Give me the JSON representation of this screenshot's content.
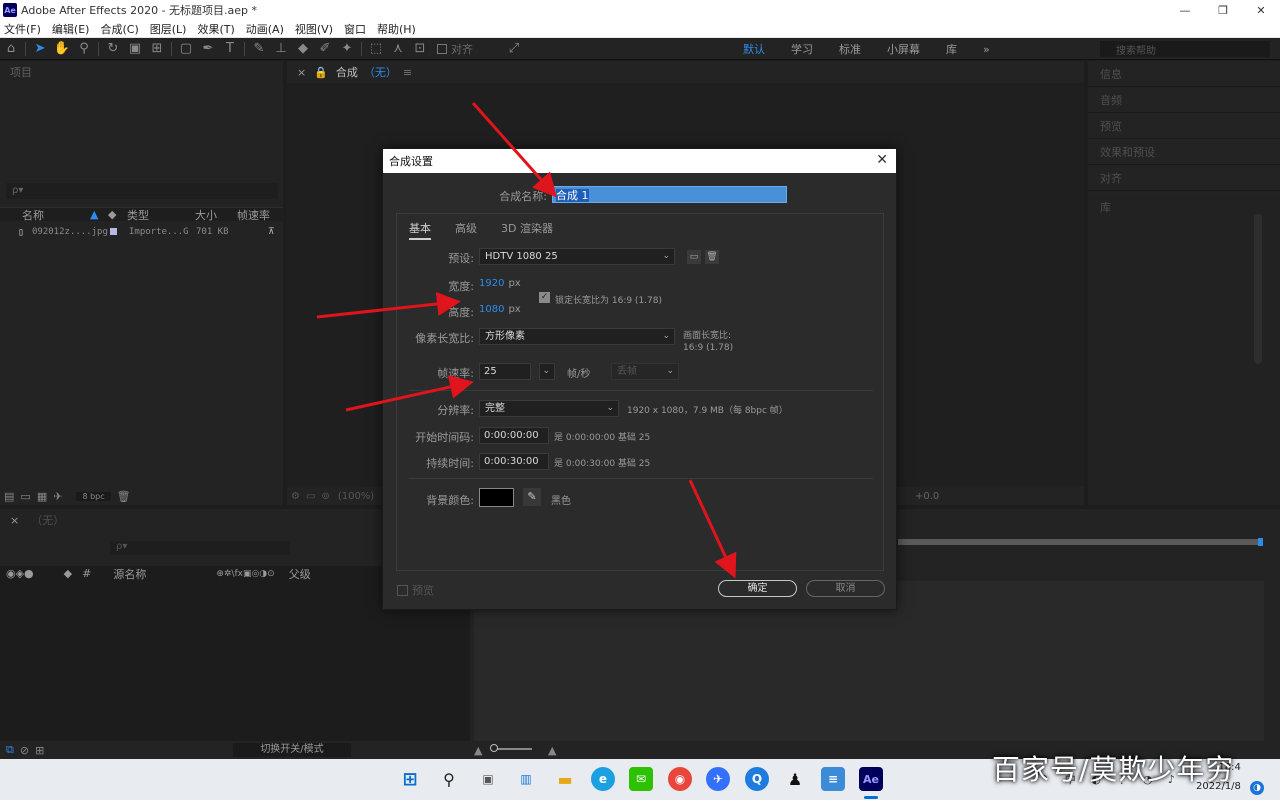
{
  "app": {
    "title": "Adobe After Effects 2020 - 无标题项目.aep *",
    "logo": "Ae",
    "accent": "#2d8ceb"
  },
  "window_controls": {
    "minimize": "—",
    "maximize": "❐",
    "close": "✕"
  },
  "menu": [
    "文件(F)",
    "编辑(E)",
    "合成(C)",
    "图层(L)",
    "效果(T)",
    "动画(A)",
    "视图(V)",
    "窗口",
    "帮助(H)"
  ],
  "toolbar": {
    "snap_label": "对齐",
    "workspaces": [
      "默认",
      "学习",
      "标准",
      "小屏幕",
      "库"
    ],
    "active_workspace": "默认",
    "search_placeholder": "搜索帮助"
  },
  "project_panel": {
    "title": "项目",
    "search_placeholder": "ρ▾",
    "columns": [
      "名称",
      "类型",
      "大小",
      "帧速率"
    ],
    "items": [
      {
        "name": "092012z....jpg",
        "type": "Importe...G",
        "size": "701 KB"
      }
    ],
    "bpc": "8 bpc"
  },
  "comp_panel": {
    "tab_label": "合成",
    "tab_value": "（无）",
    "zoom": "(100%)",
    "exposure": "+0.0"
  },
  "right_panels": [
    "信息",
    "音频",
    "预览",
    "效果和预设",
    "对齐"
  ],
  "library_label": "库",
  "timeline": {
    "tab": "（无）",
    "columns": {
      "source_name": "源名称",
      "parent": "父级",
      "hash": "#"
    },
    "toggle_label": "切换开关/模式"
  },
  "dialog": {
    "title": "合成设置",
    "name_label": "合成名称:",
    "name_value": "合成 1",
    "tabs": [
      "基本",
      "高级",
      "3D 渲染器"
    ],
    "preset_label": "预设:",
    "preset_value": "HDTV 1080 25",
    "width_label": "宽度:",
    "width_value": "1920",
    "height_label": "高度:",
    "height_value": "1080",
    "px": "px",
    "lock_aspect": "锁定长宽比为 16:9 (1.78)",
    "pixel_aspect_label": "像素长宽比:",
    "pixel_aspect_value": "方形像素",
    "frame_aspect_label": "画面长宽比:",
    "frame_aspect_value": "16:9 (1.78)",
    "fps_label": "帧速率:",
    "fps_value": "25",
    "fps_unit": "帧/秒",
    "drop_frame": "丢帧",
    "resolution_label": "分辨率:",
    "resolution_value": "完整",
    "resolution_info": "1920 x 1080，7.9 MB（每 8bpc 帧）",
    "start_tc_label": "开始时间码:",
    "start_tc_value": "0:00:00:00",
    "start_tc_info": "是 0:00:00:00  基础 25",
    "duration_label": "持续时间:",
    "duration_value": "0:00:30:00",
    "duration_info": "是 0:00:30:00  基础 25",
    "bg_label": "背景颜色:",
    "bg_color": "#000000",
    "bg_name": "黑色",
    "preview_label": "预览",
    "ok_label": "确定",
    "cancel_label": "取消",
    "close": "✕"
  },
  "taskbar": {
    "time": "18:4",
    "date": "2022/1/8",
    "active_app": "Ae"
  },
  "watermark": "百家号/莫欺少年穷"
}
